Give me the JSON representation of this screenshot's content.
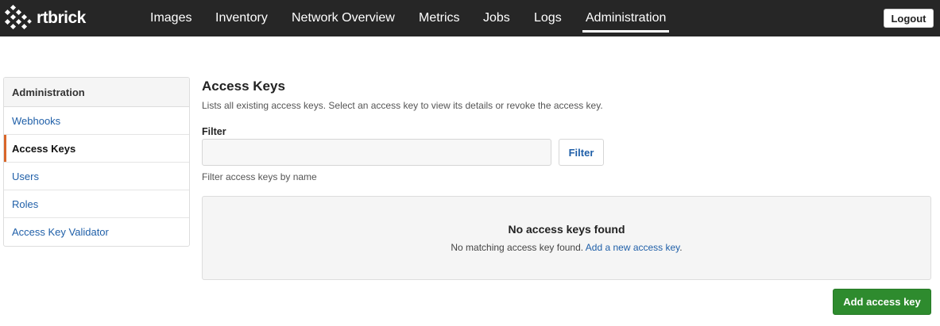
{
  "brand": {
    "logo_text": "rtbrick"
  },
  "nav": {
    "items": [
      {
        "label": "Images"
      },
      {
        "label": "Inventory"
      },
      {
        "label": "Network Overview"
      },
      {
        "label": "Metrics"
      },
      {
        "label": "Jobs"
      },
      {
        "label": "Logs"
      },
      {
        "label": "Administration",
        "active": true
      }
    ],
    "logout_label": "Logout"
  },
  "sidebar": {
    "header": "Administration",
    "items": [
      {
        "label": "Webhooks"
      },
      {
        "label": "Access Keys",
        "active": true
      },
      {
        "label": "Users"
      },
      {
        "label": "Roles"
      },
      {
        "label": "Access Key Validator"
      }
    ]
  },
  "main": {
    "title": "Access Keys",
    "description": "Lists all existing access keys. Select an access key to view its details or revoke the access key.",
    "filter": {
      "label": "Filter",
      "value": "",
      "placeholder": "",
      "button_label": "Filter",
      "help_text": "Filter access keys by name"
    },
    "empty_state": {
      "title": "No access keys found",
      "text": "No matching access key found.",
      "link_text": "Add a new access key",
      "suffix": "."
    },
    "add_button_label": "Add access key"
  },
  "colors": {
    "topbar_bg": "#262626",
    "link": "#1f5fa8",
    "active_indicator": "#d9662a",
    "primary_button": "#2e8b2e"
  },
  "icons": {
    "logo": "rtbrick-cube-logo-icon"
  }
}
